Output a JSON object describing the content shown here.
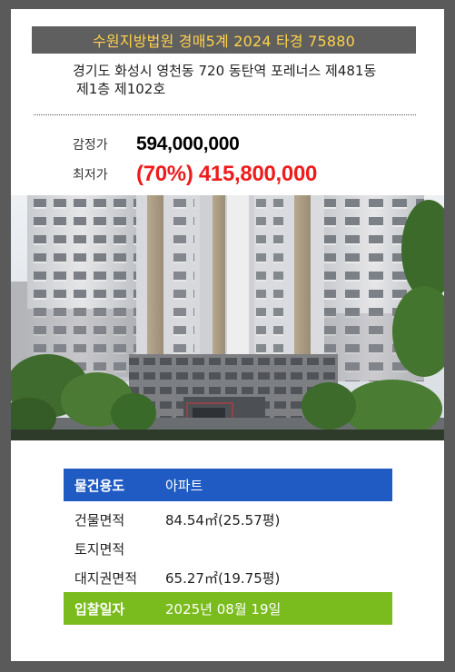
{
  "header": {
    "court_case": "수원지방법원 경매5계 2024 타경 75880"
  },
  "address": {
    "line1": "경기도 화성시 영천동 720 동탄역 포레너스 제481동",
    "line2": "제1층 제102호"
  },
  "prices": {
    "appraisal_label": "감정가",
    "appraisal_value": "594,000,000",
    "minimum_label": "최저가",
    "minimum_value": "(70%) 415,800,000"
  },
  "property_info": [
    {
      "key": "물건용도",
      "value": "아파트"
    },
    {
      "key": "건물면적",
      "value": "84.54㎡(25.57평)"
    },
    {
      "key": "토지면적",
      "value": ""
    },
    {
      "key": "대지권면적",
      "value": "65.27㎡(19.75평)"
    },
    {
      "key": "입찰일자",
      "value": "2025년 08월 19일"
    }
  ],
  "colors": {
    "header_bg": "#5f5f5f",
    "header_text": "#ffd24a",
    "minimum_price": "#ee1c1c",
    "usage_row": "#1f5bc3",
    "bid_date_row": "#7abc1e"
  }
}
